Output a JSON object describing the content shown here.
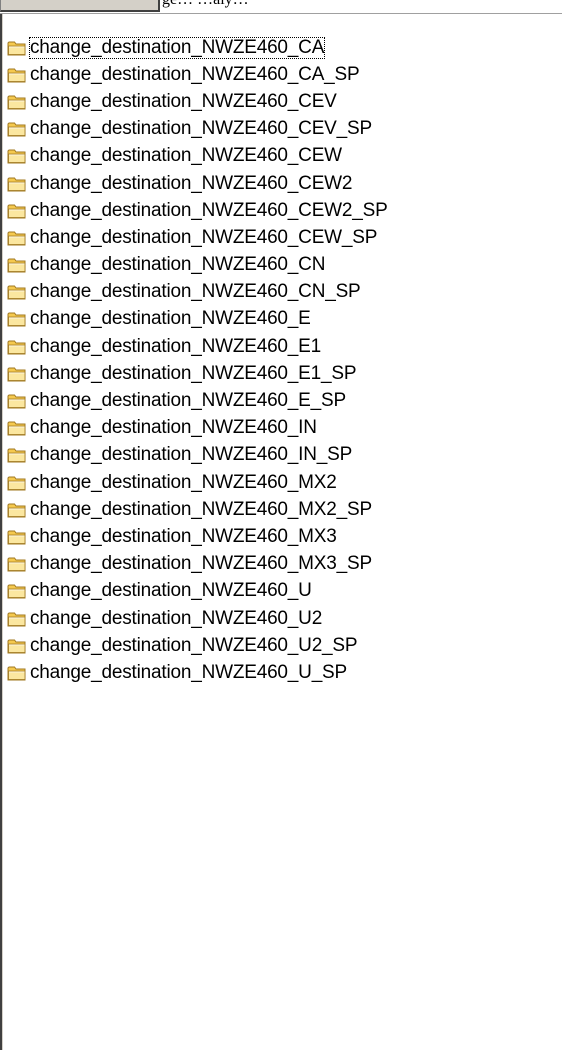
{
  "header": {
    "partial_text": "ge…   …aly…"
  },
  "folders": [
    {
      "label": "change_destination_NWZE460_CA",
      "selected": true
    },
    {
      "label": "change_destination_NWZE460_CA_SP"
    },
    {
      "label": "change_destination_NWZE460_CEV"
    },
    {
      "label": "change_destination_NWZE460_CEV_SP"
    },
    {
      "label": "change_destination_NWZE460_CEW"
    },
    {
      "label": "change_destination_NWZE460_CEW2"
    },
    {
      "label": "change_destination_NWZE460_CEW2_SP"
    },
    {
      "label": "change_destination_NWZE460_CEW_SP"
    },
    {
      "label": "change_destination_NWZE460_CN"
    },
    {
      "label": "change_destination_NWZE460_CN_SP"
    },
    {
      "label": "change_destination_NWZE460_E"
    },
    {
      "label": "change_destination_NWZE460_E1"
    },
    {
      "label": "change_destination_NWZE460_E1_SP"
    },
    {
      "label": "change_destination_NWZE460_E_SP"
    },
    {
      "label": "change_destination_NWZE460_IN"
    },
    {
      "label": "change_destination_NWZE460_IN_SP"
    },
    {
      "label": "change_destination_NWZE460_MX2"
    },
    {
      "label": "change_destination_NWZE460_MX2_SP"
    },
    {
      "label": "change_destination_NWZE460_MX3"
    },
    {
      "label": "change_destination_NWZE460_MX3_SP"
    },
    {
      "label": "change_destination_NWZE460_U"
    },
    {
      "label": "change_destination_NWZE460_U2"
    },
    {
      "label": "change_destination_NWZE460_U2_SP"
    },
    {
      "label": "change_destination_NWZE460_U_SP"
    }
  ],
  "icons": {
    "folder": "folder-icon"
  },
  "colors": {
    "folder_fill": "#f5c94e",
    "folder_fill_light": "#fbe7a0",
    "folder_outline": "#a07820",
    "selection_outline": "#000000"
  }
}
